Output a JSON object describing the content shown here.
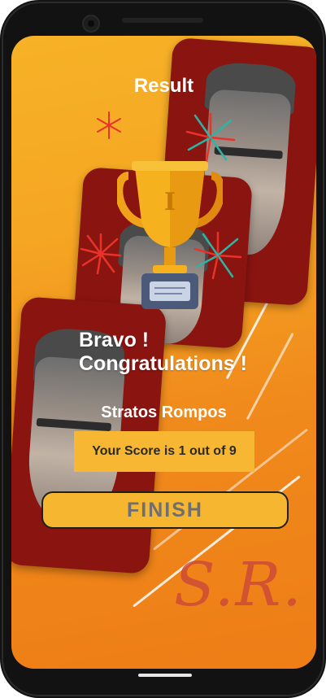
{
  "app": {
    "title": "Result"
  },
  "result": {
    "message": "Bravo ! Congratulations !",
    "player_name": "Stratos Rompos",
    "score_text": "Your Score is 1 out of 9"
  },
  "actions": {
    "finish_label": "FINISH"
  },
  "branding": {
    "watermark": "S.R."
  },
  "colors": {
    "background_start": "#f7b227",
    "background_end": "#ee7d16",
    "score_box": "#f8b733",
    "finish_button": "#f6b62f",
    "finish_text": "#6f6f6f",
    "photo_frame": "#8a1410",
    "watermark": "#c9443a"
  },
  "icons": {
    "trophy": "trophy-icon",
    "fireworks": "firework-icon"
  }
}
